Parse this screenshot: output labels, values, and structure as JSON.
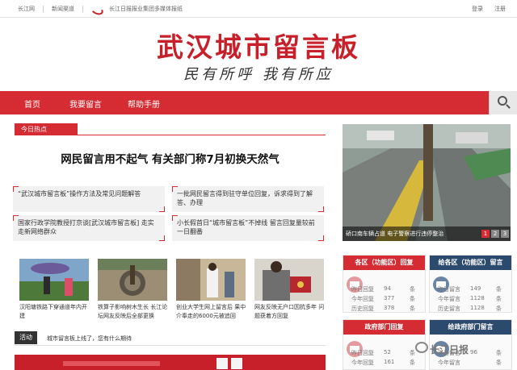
{
  "topbar": {
    "site": "长江网",
    "channel": "新闻渠道",
    "group": "长江日报报业集团多媒体报纸",
    "login": "登录",
    "register": "注册"
  },
  "masthead": {
    "title": "武汉城市留言板",
    "slogan": "民有所呼 我有所应"
  },
  "nav": {
    "items": [
      "首页",
      "我要留言",
      "帮助手册"
    ]
  },
  "hot": {
    "tag": "今日热点",
    "headline": "网民留言用不起气 有关部门称7月初换天然气"
  },
  "news": [
    "“武汉城市留言板”操作方法及常见问题解答",
    "一批网民留言得到驻守单位回复，诉求得到了解答、办理",
    "国家行政学院教授打京谈[武汉城市留言板] 走实走新网络群众",
    "小长假首日“城市留言板”不掉线 留言回复量较前一日翻番"
  ],
  "photos": [
    {
      "caption": "汉阳塘铁路下穿通道年内开建"
    },
    {
      "caption": "铁算子影响树木生长 长江论坛网友反映后全部更换"
    },
    {
      "caption": "创业大学生网上留言后 果中介奉走的6000元被追回"
    },
    {
      "caption": "网友反映无户口因抗多年 问题获着方回复"
    }
  ],
  "activity": {
    "tag": "活动",
    "text": "城市留言板上线了，您有什么期待"
  },
  "feature": {
    "caption": "硚口南车辆占道 电子警察进行违停整治",
    "pages": [
      "1",
      "2",
      "3"
    ]
  },
  "panels": [
    {
      "title": "各区（功能区）回复",
      "color": "#d52b33",
      "stats": [
        {
          "label": "昨日回复",
          "value": "94",
          "unit": "条"
        },
        {
          "label": "今年回复",
          "value": "377",
          "unit": "条"
        },
        {
          "label": "历史回复",
          "value": "378",
          "unit": "条"
        }
      ]
    },
    {
      "title": "给各区（功能区）留言",
      "color": "#2c4a6e",
      "stats": [
        {
          "label": "昨日留言",
          "value": "149",
          "unit": "条"
        },
        {
          "label": "今年留言",
          "value": "1128",
          "unit": "条"
        },
        {
          "label": "历史留言",
          "value": "1128",
          "unit": "条"
        }
      ]
    },
    {
      "title": "政府部门回复",
      "color": "#d52b33",
      "stats": [
        {
          "label": "昨日回复",
          "value": "52",
          "unit": "条"
        },
        {
          "label": "今年回复",
          "value": "161",
          "unit": "条"
        }
      ]
    },
    {
      "title": "给政府部门留言",
      "color": "#2c4a6e",
      "stats": [
        {
          "label": "昨日留言",
          "value": "96",
          "unit": "条"
        },
        {
          "label": "今年留言",
          "value": "",
          "unit": "条"
        }
      ]
    }
  ],
  "watermark": "长江日报"
}
